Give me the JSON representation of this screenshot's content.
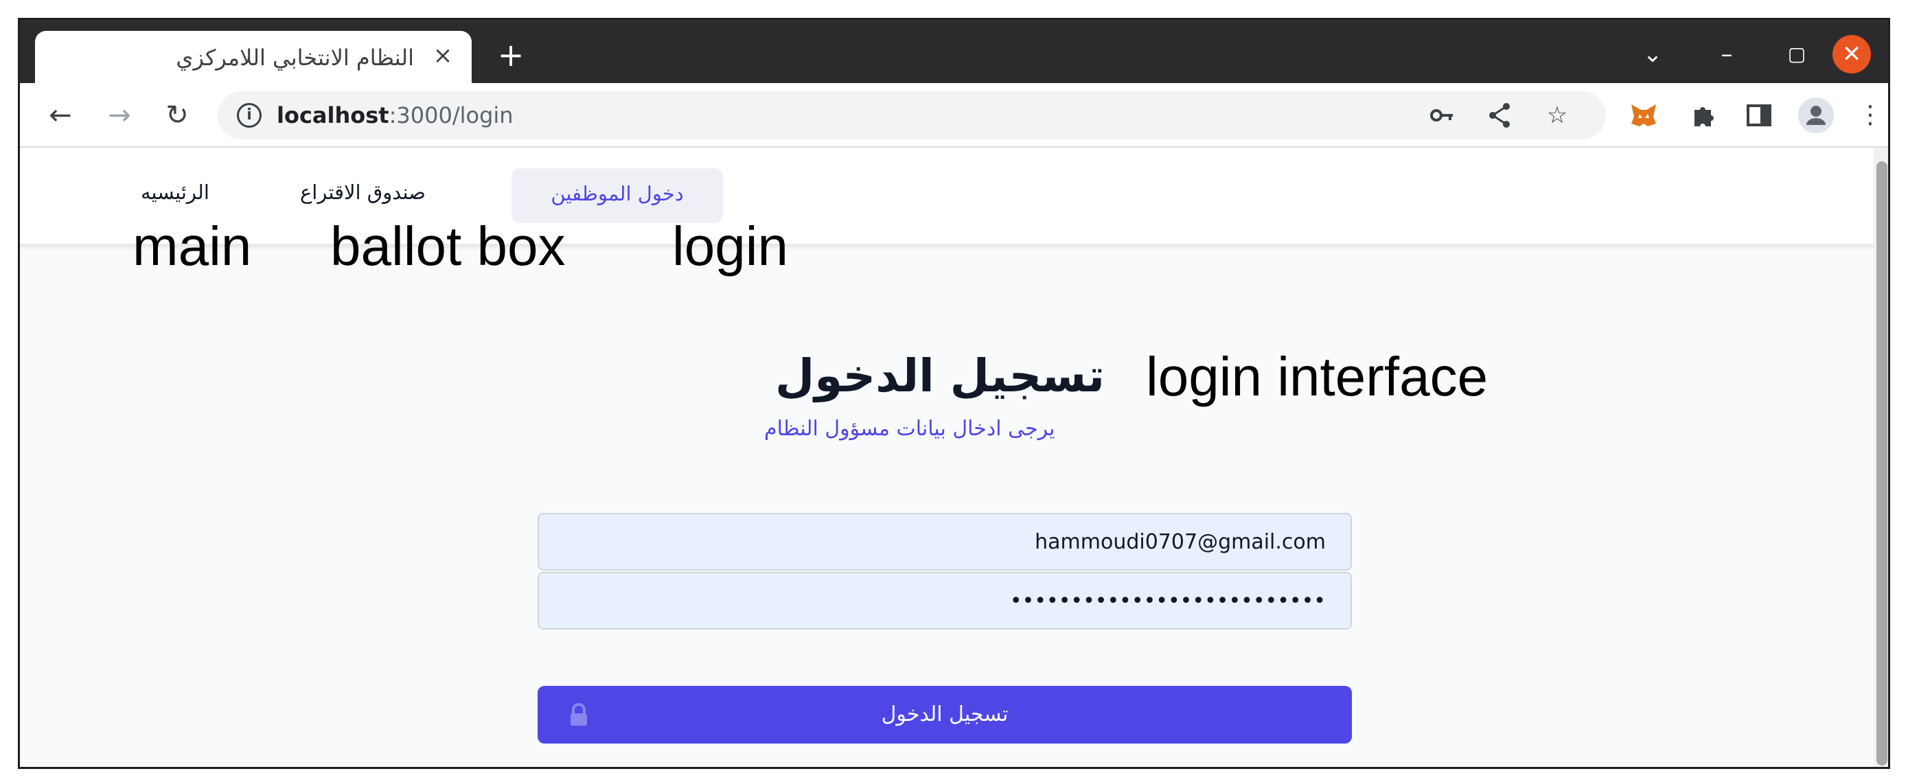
{
  "browser": {
    "tab_title": "النظام الانتخابي اللامركزي",
    "tab_close": "×",
    "new_tab": "+",
    "url_host": "localhost",
    "url_rest": ":3000/login",
    "window_controls": {
      "chevron": "⌄",
      "minimize": "–",
      "maximize": "▢",
      "close": "✕"
    },
    "nav": {
      "back": "←",
      "forward": "→",
      "reload": "↻"
    },
    "icons": [
      "key-icon",
      "share-icon",
      "star-icon",
      "metamask-icon",
      "puzzle-icon",
      "sidepanel-icon",
      "profile-icon",
      "kebab-menu-icon"
    ]
  },
  "navbar": {
    "home": "الرئيسيه",
    "ballot_box": "صندوق الاقتراع",
    "staff_login": "دخول الموظفين"
  },
  "annotations": {
    "main": "main",
    "ballot_box": "ballot box",
    "login": "login",
    "login_interface": "login interface"
  },
  "login": {
    "title": "تسجيل الدخول",
    "subtitle": "يرجى ادخال بيانات مسؤول النظام",
    "email_value": "hammoudi0707@gmail.com",
    "password_value": "••••••••••••••••••••••••••",
    "submit_label": "تسجيل الدخول"
  },
  "colors": {
    "accent": "#4f46e5",
    "input_bg": "#e8f0fe",
    "titlebar": "#2b2b2d",
    "close_button": "#e95420"
  }
}
